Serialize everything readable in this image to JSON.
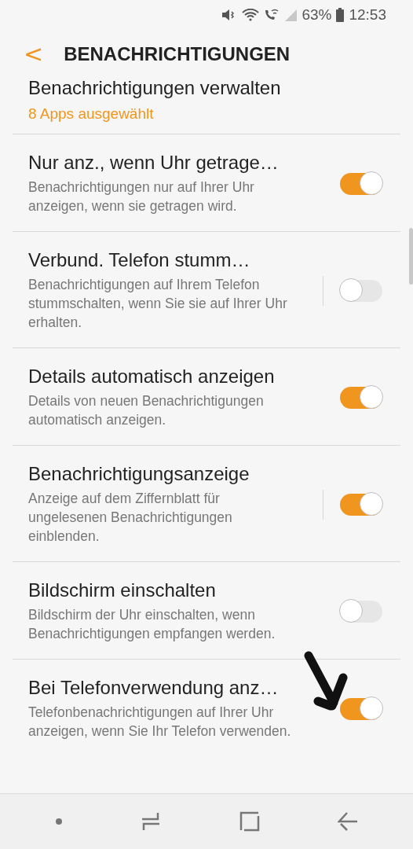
{
  "status_bar": {
    "battery": "63%",
    "time": "12:53"
  },
  "header": {
    "back": "<",
    "title": "BENACHRICHTIGUNGEN"
  },
  "top_item": {
    "title": "Benachrichtigungen verwalten",
    "value": "8 Apps ausgewählt"
  },
  "settings": [
    {
      "title": "Nur anz., wenn Uhr getrage…",
      "description": "Benachrichtigungen nur auf Ihrer Uhr anzeigen, wenn sie getragen wird.",
      "on": true,
      "separator": false
    },
    {
      "title": "Verbund. Telefon stumm…",
      "description": "Benachrichtigungen auf Ihrem Telefon stummschalten, wenn Sie sie auf Ihrer Uhr erhalten.",
      "on": false,
      "separator": true
    },
    {
      "title": "Details automatisch anzeigen",
      "description": "Details von neuen Benachrichtigungen automatisch anzeigen.",
      "on": true,
      "separator": false
    },
    {
      "title": "Benachrichtigungsanzeige",
      "description": "Anzeige auf dem Ziffernblatt für ungelesenen Benachrichtigungen einblenden.",
      "on": true,
      "separator": true
    },
    {
      "title": "Bildschirm einschalten",
      "description": "Bildschirm der Uhr einschalten, wenn Benachrichtigungen empfangen werden.",
      "on": false,
      "separator": false
    },
    {
      "title": "Bei Telefonverwendung anz…",
      "description": "Telefonbenachrichtigungen auf Ihrer Uhr anzeigen, wenn Sie Ihr Telefon verwenden.",
      "on": true,
      "separator": false
    }
  ]
}
